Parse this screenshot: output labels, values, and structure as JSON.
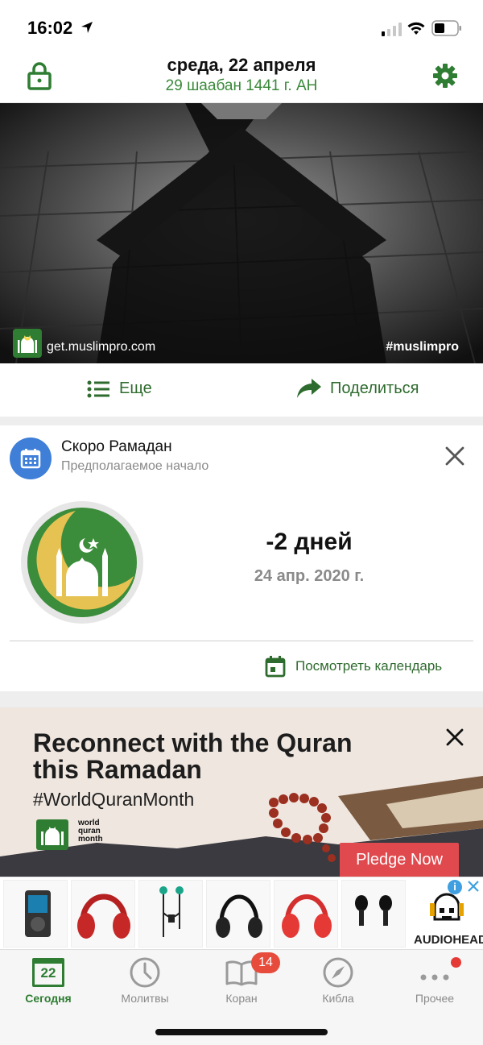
{
  "status_bar": {
    "time": "16:02"
  },
  "header": {
    "date": "среда, 22 апреля",
    "hijri_date": "29 шаабан 1441 г. AH"
  },
  "hero": {
    "url": "get.muslimpro.com",
    "hashtag": "#muslimpro"
  },
  "actions": {
    "more_label": "Еще",
    "share_label": "Поделиться"
  },
  "ramadan_card": {
    "title": "Скоро Рамадан",
    "subtitle": "Предполагаемое начало",
    "countdown": "-2 дней",
    "date": "24 апр. 2020 г.",
    "calendar_link": "Посмотреть календарь"
  },
  "promo": {
    "headline": "Reconnect with the Quran this Ramadan",
    "hashtag": "#WorldQuranMonth",
    "logo_text": "world quran month",
    "button": "Pledge Now"
  },
  "ad": {
    "brand": "AUDIOHEAD",
    "products": [
      "mp3-player",
      "red-headphones",
      "earphones",
      "black-headphones",
      "red-headphones",
      "black-earphones"
    ]
  },
  "tabs": [
    {
      "label": "Сегодня",
      "icon": "calendar-icon",
      "day": "22",
      "active": true
    },
    {
      "label": "Молитвы",
      "icon": "clock-icon",
      "active": false
    },
    {
      "label": "Коран",
      "icon": "book-icon",
      "badge": "14",
      "active": false
    },
    {
      "label": "Кибла",
      "icon": "compass-icon",
      "active": false
    },
    {
      "label": "Прочее",
      "icon": "more-dots-icon",
      "active": false
    }
  ],
  "colors": {
    "accent_green": "#2e7d32",
    "badge_red": "#e64b3b",
    "pledge_red": "#e0494d",
    "calendar_blue": "#3f7fd8"
  }
}
